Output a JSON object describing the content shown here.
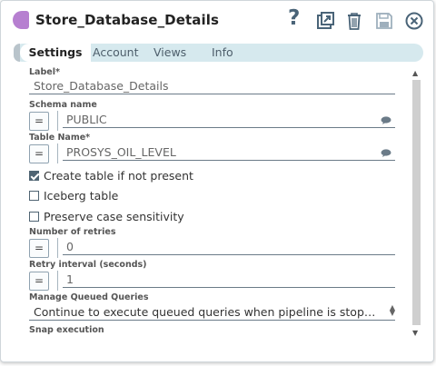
{
  "header": {
    "title": "Store_Database_Details",
    "help_glyph": "?"
  },
  "tabs": [
    {
      "label": "Settings",
      "active": true
    },
    {
      "label": "Account",
      "active": false
    },
    {
      "label": "Views",
      "active": false
    },
    {
      "label": "Info",
      "active": false
    }
  ],
  "form": {
    "label": {
      "label": "Label*",
      "value": "Store_Database_Details"
    },
    "schema": {
      "label": "Schema name",
      "button": "=",
      "value": "PUBLIC"
    },
    "table": {
      "label": "Table Name*",
      "button": "=",
      "value": "PROSYS_OIL_LEVEL"
    },
    "create_table": {
      "label": "Create table if not present",
      "checked": true
    },
    "iceberg": {
      "label": "Iceberg table",
      "checked": false
    },
    "preserve_case": {
      "label": "Preserve case sensitivity",
      "checked": false
    },
    "retries": {
      "label": "Number of retries",
      "button": "=",
      "value": "0"
    },
    "retry_interval": {
      "label": "Retry interval (seconds)",
      "button": "=",
      "value": "1"
    },
    "queued": {
      "label": "Manage Queued Queries",
      "value": "Continue to execute queued queries when pipeline is stopped o..."
    },
    "snap_execution": {
      "label": "Snap execution"
    }
  },
  "colors": {
    "accent": "#b67fd0",
    "tab_bar": "#d6e9ee",
    "icon": "#4a6478"
  }
}
